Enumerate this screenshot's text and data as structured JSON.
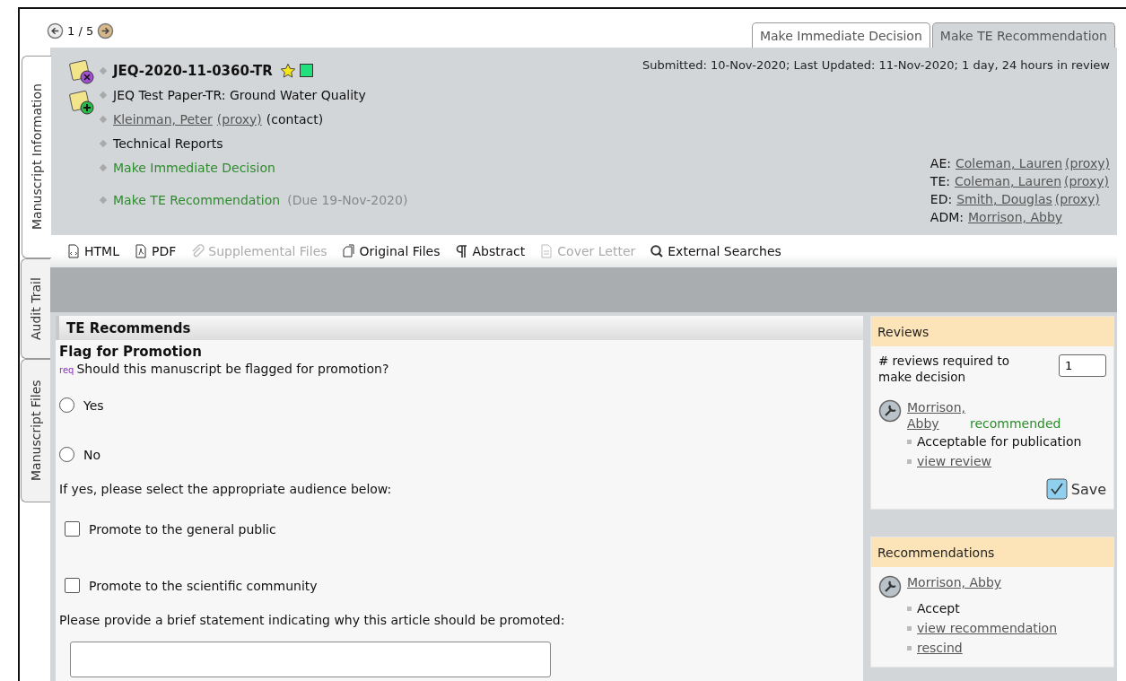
{
  "pager": {
    "position": "1 / 5"
  },
  "tabs": [
    {
      "label": "Make Immediate Decision",
      "selected": true
    },
    {
      "label": "Make TE Recommendation",
      "selected": false
    }
  ],
  "side_tabs": [
    {
      "label": "Manuscript Information",
      "selected": true
    },
    {
      "label": "Audit Trail",
      "selected": false
    },
    {
      "label": "Manuscript Files",
      "selected": false
    }
  ],
  "manuscript": {
    "id": "JEQ-2020-11-0360-TR",
    "title": "JEQ Test Paper-TR: Ground Water Quality",
    "author": {
      "name": "Kleinman, Peter",
      "proxy": "(proxy)",
      "role": "(contact)"
    },
    "type": "Technical Reports",
    "actions": [
      {
        "label": "Make Immediate Decision"
      },
      {
        "label": "Make TE Recommendation",
        "note": "(Due 19-Nov-2020)"
      }
    ],
    "history": "Submitted: 10-Nov-2020; Last Updated: 11-Nov-2020; 1 day, 24 hours in review",
    "editors": [
      {
        "role": "AE:",
        "name": "Coleman, Lauren",
        "proxy": "(proxy)"
      },
      {
        "role": "TE:",
        "name": "Coleman, Lauren",
        "proxy": "(proxy)"
      },
      {
        "role": "ED:",
        "name": "Smith, Douglas",
        "proxy": "(proxy)"
      },
      {
        "role": "ADM:",
        "name": "Morrison, Abby"
      }
    ]
  },
  "toolbar": [
    {
      "label": "HTML",
      "kind": "html",
      "disabled": false
    },
    {
      "label": "PDF",
      "kind": "pdf",
      "disabled": false
    },
    {
      "label": "Supplemental Files",
      "kind": "clip",
      "disabled": true
    },
    {
      "label": "Original Files",
      "kind": "files",
      "disabled": false
    },
    {
      "label": "Abstract",
      "kind": "pilcrow",
      "disabled": false
    },
    {
      "label": "Cover Letter",
      "kind": "doc",
      "disabled": true
    },
    {
      "label": "External Searches",
      "kind": "search",
      "disabled": false
    }
  ],
  "form": {
    "header": "TE Recommends",
    "section": "Flag for Promotion",
    "required": "req",
    "question": "Should this manuscript be flagged for promotion?",
    "options": [
      {
        "label": "Yes",
        "selected": false
      },
      {
        "label": "No",
        "selected": false
      }
    ],
    "audience_prompt": "If yes, please select the appropriate audience below:",
    "audience": [
      {
        "label": "Promote to the general public",
        "checked": false
      },
      {
        "label": "Promote to the scientific community",
        "checked": false
      }
    ],
    "statement_prompt": "Please provide a brief statement indicating why this article should be promoted:"
  },
  "reviews": {
    "title": "Reviews",
    "required_label": "# reviews required to make decision",
    "required_value": "1",
    "reviewer": {
      "name": "Morrison, Abby",
      "status": "recommended",
      "details": [
        {
          "text": "Acceptable for publication",
          "kind": "text"
        },
        {
          "text": "view review",
          "kind": "link"
        }
      ]
    },
    "save": "Save"
  },
  "recommendations": {
    "title": "Recommendations",
    "reviewer": {
      "name": "Morrison, Abby",
      "details": [
        {
          "text": "Accept",
          "kind": "text"
        },
        {
          "text": "view recommendation",
          "kind": "link"
        },
        {
          "text": "rescind",
          "kind": "link"
        }
      ]
    }
  }
}
